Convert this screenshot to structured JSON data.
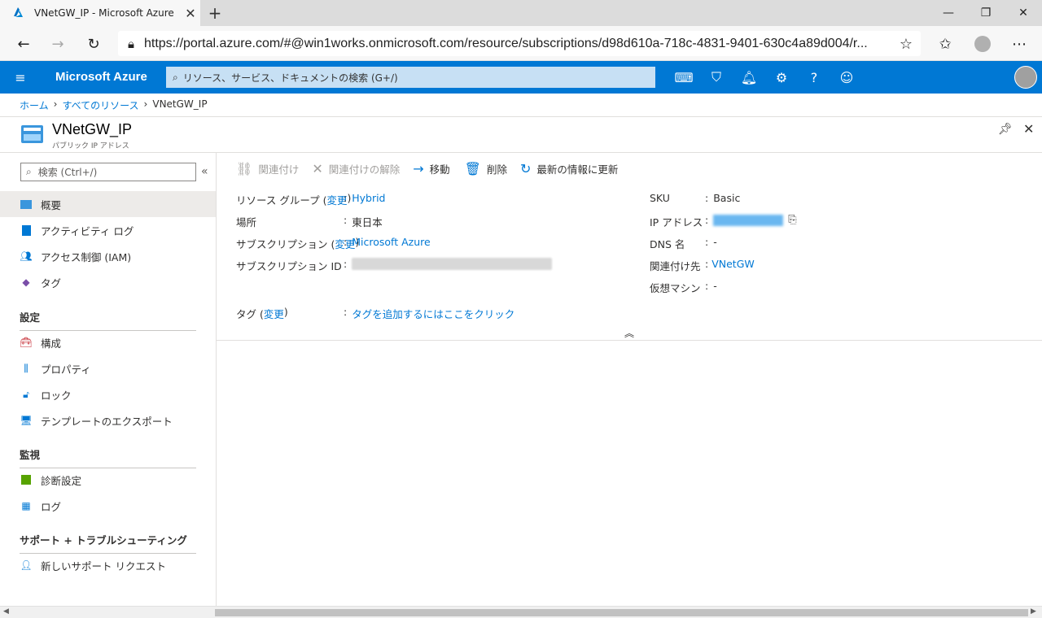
{
  "browser": {
    "tab_title": "VNetGW_IP - Microsoft Azure",
    "url": "https://portal.azure.com/#@win1works.onmicrosoft.com/resource/subscriptions/d98d610a-718c-4831-9401-630c4a89d004/r..."
  },
  "azure": {
    "brand": "Microsoft Azure",
    "search_placeholder": "リソース、サービス、ドキュメントの検索 (G+/)"
  },
  "breadcrumb": {
    "home": "ホーム",
    "all_resources": "すべてのリソース",
    "current": "VNetGW_IP"
  },
  "resource": {
    "name": "VNetGW_IP",
    "type": "パブリック IP アドレス"
  },
  "sidebar": {
    "search_placeholder": "検索 (Ctrl+/)",
    "top_items": [
      {
        "label": "概要"
      },
      {
        "label": "アクティビティ ログ"
      },
      {
        "label": "アクセス制御 (IAM)"
      },
      {
        "label": "タグ"
      }
    ],
    "sections": [
      {
        "title": "設定",
        "items": [
          {
            "label": "構成"
          },
          {
            "label": "プロパティ"
          },
          {
            "label": "ロック"
          },
          {
            "label": "テンプレートのエクスポート"
          }
        ]
      },
      {
        "title": "監視",
        "items": [
          {
            "label": "診断設定"
          },
          {
            "label": "ログ"
          }
        ]
      },
      {
        "title": "サポート + トラブルシューティング",
        "items": [
          {
            "label": "新しいサポート リクエスト"
          }
        ]
      }
    ]
  },
  "toolbar": {
    "associate": "関連付け",
    "dissociate": "関連付けの解除",
    "move": "移動",
    "delete": "削除",
    "refresh": "最新の情報に更新"
  },
  "essentials": {
    "left": [
      {
        "label": "リソース グループ (",
        "change": "変更",
        "close": ")",
        "value": "Hybrid"
      },
      {
        "label": "場所",
        "value": "東日本"
      },
      {
        "label": "サブスクリプション (",
        "change": "変更",
        "close": ")",
        "value": "Microsoft Azure"
      },
      {
        "label": "サブスクリプション ID",
        "value": "d98d610a-718c-4831-9401-630c4a89d004"
      }
    ],
    "right": [
      {
        "label": "SKU",
        "value": "Basic"
      },
      {
        "label": "IP アドレス",
        "value": ""
      },
      {
        "label": "DNS 名",
        "value": "-"
      },
      {
        "label": "関連付け先",
        "value": "VNetGW"
      },
      {
        "label": "仮想マシン",
        "value": "-"
      }
    ],
    "tags_label": "タグ (",
    "tags_change": "変更",
    "tags_close": ")",
    "tags_value": "タグを追加するにはここをクリック",
    "separator": ":"
  }
}
